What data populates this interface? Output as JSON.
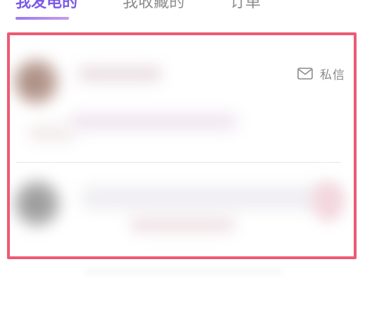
{
  "tabs": [
    {
      "label": "我发电的",
      "active": true
    },
    {
      "label": "我收藏的",
      "active": false
    },
    {
      "label": "订单",
      "active": false
    }
  ],
  "message_action": {
    "label": "私信",
    "icon": "mail-icon"
  },
  "colors": {
    "accent": "#7c5be7",
    "highlight_border": "#ee5a72",
    "muted_text": "#8a8a8a",
    "divider": "#e6e6ea"
  }
}
